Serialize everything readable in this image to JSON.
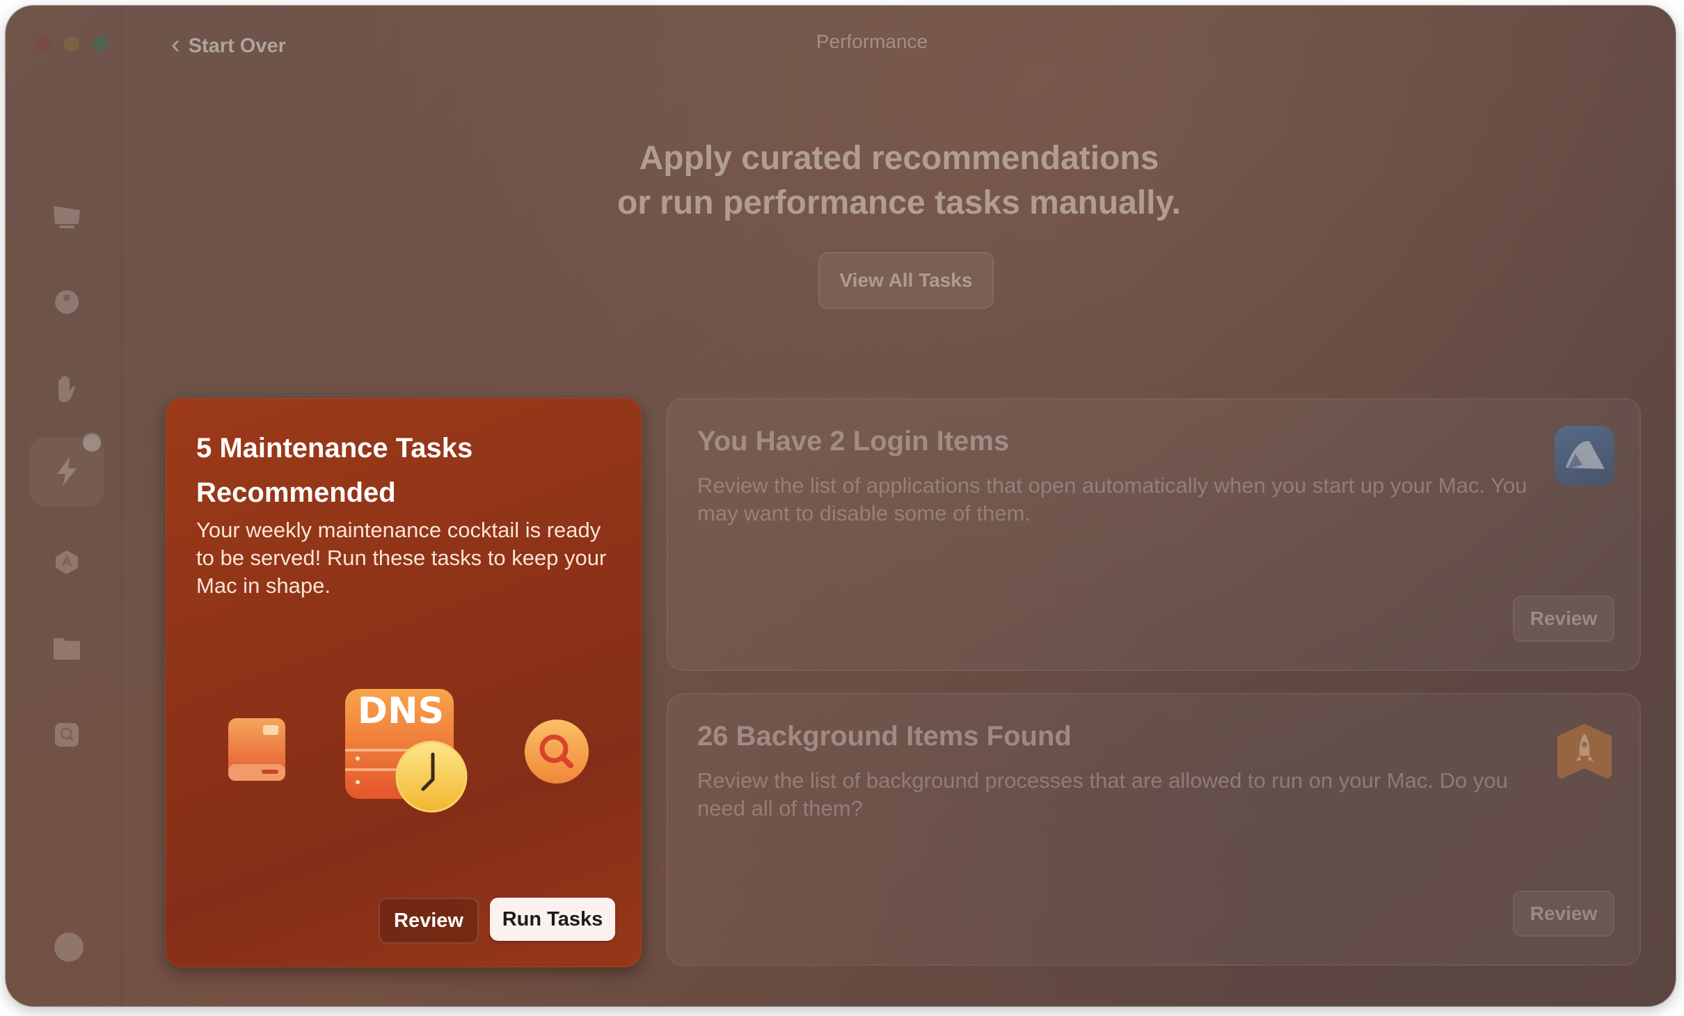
{
  "window": {
    "title": "Performance",
    "back_label": "Start Over"
  },
  "sidebar": {
    "items": [
      {
        "name": "monitor-icon"
      },
      {
        "name": "shield-icon"
      },
      {
        "name": "hand-icon"
      },
      {
        "name": "lightning-icon",
        "active": true
      },
      {
        "name": "apps-icon"
      },
      {
        "name": "folder-icon"
      },
      {
        "name": "disk-search-icon"
      }
    ],
    "bottom_icon": "assistant-icon"
  },
  "main": {
    "headline_line1": "Apply curated recommendations",
    "headline_line2": "or run performance tasks manually.",
    "view_all_label": "View All Tasks"
  },
  "featured_card": {
    "title": "5 Maintenance Tasks Recommended",
    "description": "Your weekly maintenance cocktail is ready to be served! Run these tasks to keep your Mac in shape.",
    "dns_label": "DNS",
    "review_label": "Review",
    "run_label": "Run Tasks",
    "colors": {
      "card": "#8e3318",
      "run_button": "#fbf1ee"
    }
  },
  "cards": [
    {
      "title": "You Have 2 Login Items",
      "description": "Review the list of applications that open automatically when you start up your Mac. You may want to disable some of them.",
      "button_label": "Review",
      "icon": "login-items-icon"
    },
    {
      "title": "26 Background Items Found",
      "description": "Review the list of background processes that are allowed to run on your Mac. Do you need all of them?",
      "button_label": "Review",
      "icon": "rocket-icon"
    }
  ]
}
